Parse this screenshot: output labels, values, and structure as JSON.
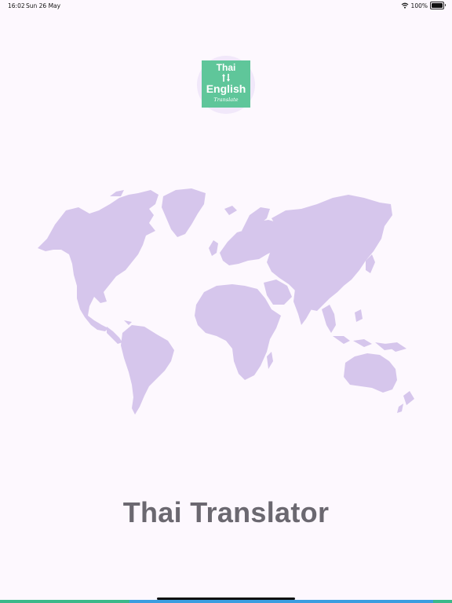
{
  "status_bar": {
    "time": "16:02",
    "date": "Sun 26 May",
    "battery": "100%",
    "icons": [
      "wifi-icon",
      "battery-icon"
    ]
  },
  "logo": {
    "line1": "Thai",
    "line2": "English",
    "line3": "Translate",
    "icon": "swap-arrows-icon",
    "background_color": "#5fc69a"
  },
  "map": {
    "icon": "world-map",
    "color": "#d6c6ec"
  },
  "app_title": "Thai Translator",
  "colors": {
    "background": "#fdf8fe",
    "title": "#6b6870",
    "bar_green": "#3ab88a",
    "bar_blue": "#3a9de0"
  }
}
